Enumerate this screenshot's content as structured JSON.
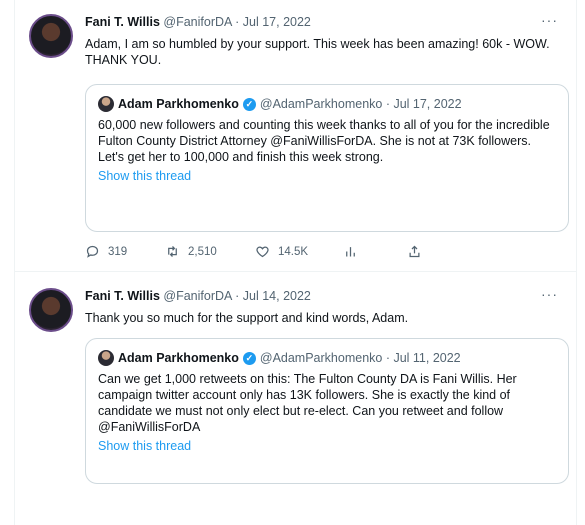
{
  "tweets": [
    {
      "author_name": "Fani T. Willis",
      "meta": "@FaniforDA · Jul 17, 2022",
      "more": "···",
      "text": "Adam, I am so humbled by your support.  This week has been amazing! 60k - WOW.  THANK YOU.",
      "quote": {
        "author_name": "Adam Parkhomenko",
        "meta": "@AdamParkhomenko · Jul 17, 2022",
        "text": "60,000 new followers and counting this week thanks to all of you for the incredible Fulton County District Attorney @FaniWillisForDA. She is not at 73K followers. Let's get her to 100,000 and finish this week strong.",
        "show_thread": "Show this thread"
      },
      "actions": {
        "replies": "319",
        "retweets": "2,510",
        "likes": "14.5K"
      }
    },
    {
      "author_name": "Fani T. Willis",
      "meta": "@FaniforDA · Jul 14, 2022",
      "more": "···",
      "text": "Thank you so much for the support and kind words, Adam.",
      "quote": {
        "author_name": "Adam Parkhomenko",
        "meta": "@AdamParkhomenko · Jul 11, 2022",
        "text": "Can we get 1,000 retweets on this: The Fulton County DA is Fani Willis. Her campaign twitter account only has 13K followers. She is exactly the kind of candidate we must not only elect but re-elect. Can you retweet and follow @FaniWillisForDA",
        "show_thread": "Show this thread"
      }
    }
  ],
  "icons": [
    "reply-icon",
    "retweet-icon",
    "like-icon",
    "analytics-icon",
    "share-icon",
    "verified-badge-icon"
  ],
  "colors": {
    "link": "#1d9bf0",
    "meta": "#536471",
    "border": "#cfd9de",
    "verified": "#1d9bf0"
  }
}
